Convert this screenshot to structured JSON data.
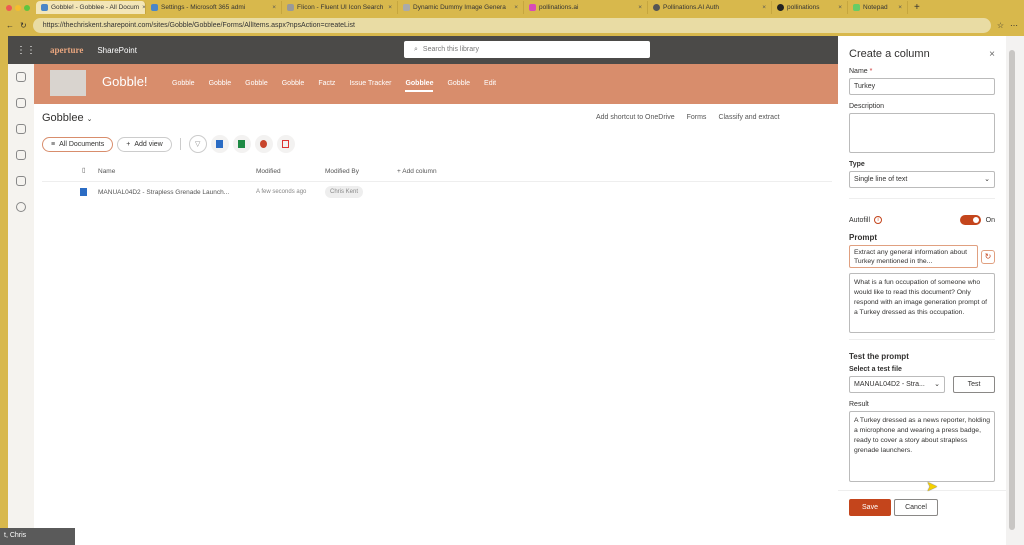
{
  "browser": {
    "tabs": [
      {
        "label": "Gobble! - Gobblee - All Docum",
        "active": true
      },
      {
        "label": "Settings - Microsoft 365 admi"
      },
      {
        "label": "FIicon - Fluent UI Icon Search"
      },
      {
        "label": "Dynamic Dummy Image Genera"
      },
      {
        "label": "pollinations.ai"
      },
      {
        "label": "Pollinations.AI Auth"
      },
      {
        "label": "pollinations"
      },
      {
        "label": "Notepad"
      }
    ],
    "url": "https://thechriskent.sharepoint.com/sites/Gobble/Gobblee/Forms/AllItems.aspx?npsAction=createList"
  },
  "suite": {
    "logo": "aperture",
    "app": "SharePoint",
    "search_placeholder": "Search this library"
  },
  "site": {
    "title": "Gobble!",
    "nav": [
      "Gobble",
      "Gobble",
      "Gobble",
      "Gobble",
      "Factz",
      "Issue Tracker",
      "Gobblee",
      "Gobble",
      "Edit"
    ],
    "selected_nav": "Gobblee"
  },
  "library": {
    "title": "Gobblee",
    "actions": [
      "Add shortcut to OneDrive",
      "Forms",
      "Classify and extract"
    ],
    "view": "All Documents",
    "add_view": "Add view",
    "columns": [
      "Name",
      "Modified",
      "Modified By",
      "Add column"
    ],
    "rows": [
      {
        "name": "MANUAL04D2 - Strapless Grenade Launch...",
        "modified": "A few seconds ago",
        "modified_by": "Chris Kent"
      }
    ]
  },
  "panel": {
    "title": "Create a column",
    "name_label": "Name",
    "required": "*",
    "name_value": "Turkey",
    "description_label": "Description",
    "description_value": "",
    "type_label": "Type",
    "type_value": "Single line of text",
    "autofill_label": "Autofill",
    "autofill_state": "On",
    "autofill_on": true,
    "prompt_label": "Prompt",
    "prompt_summary": "Extract any general information about Turkey mentioned in the...",
    "prompt_text": "What is a fun occupation of someone who would like to read this document? Only respond with an image generation prompt of a Turkey dressed as this occupation.",
    "test_heading": "Test the prompt",
    "select_label": "Select a test file",
    "select_value": "MANUAL04D2 - Stra...",
    "test_button": "Test",
    "result_label": "Result",
    "result_text": "A Turkey dressed as a news reporter, holding a microphone and wearing a press badge, ready to cover a story about strapless grenade launchers.",
    "save": "Save",
    "cancel": "Cancel"
  },
  "colors": {
    "accent": "#c4451c",
    "hero": "#d88d6c",
    "suite": "#4b4a48"
  },
  "overlay": {
    "text": "t, Chris"
  }
}
